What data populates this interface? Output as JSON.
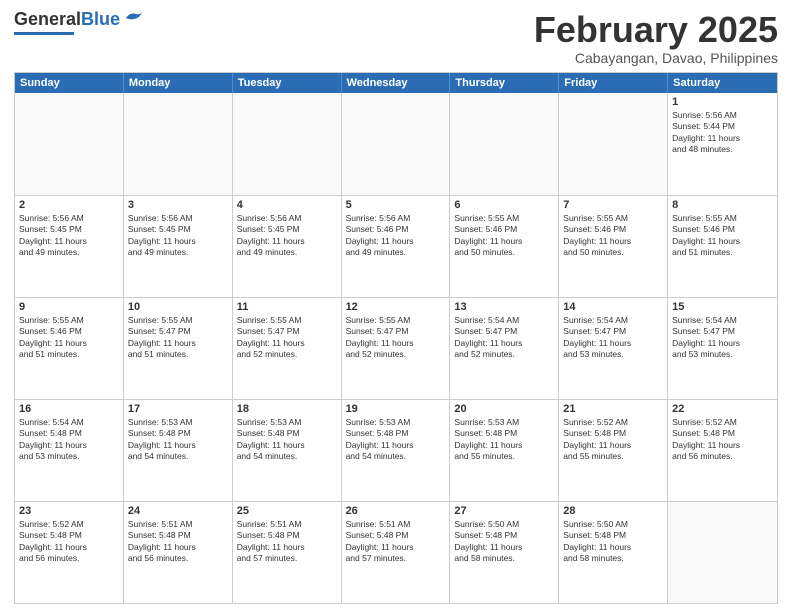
{
  "header": {
    "logo_general": "General",
    "logo_blue": "Blue",
    "month_year": "February 2025",
    "location": "Cabayangan, Davao, Philippines"
  },
  "weekdays": [
    "Sunday",
    "Monday",
    "Tuesday",
    "Wednesday",
    "Thursday",
    "Friday",
    "Saturday"
  ],
  "weeks": [
    [
      {
        "day": "",
        "info": ""
      },
      {
        "day": "",
        "info": ""
      },
      {
        "day": "",
        "info": ""
      },
      {
        "day": "",
        "info": ""
      },
      {
        "day": "",
        "info": ""
      },
      {
        "day": "",
        "info": ""
      },
      {
        "day": "1",
        "info": "Sunrise: 5:56 AM\nSunset: 5:44 PM\nDaylight: 11 hours\nand 48 minutes."
      }
    ],
    [
      {
        "day": "2",
        "info": "Sunrise: 5:56 AM\nSunset: 5:45 PM\nDaylight: 11 hours\nand 49 minutes."
      },
      {
        "day": "3",
        "info": "Sunrise: 5:56 AM\nSunset: 5:45 PM\nDaylight: 11 hours\nand 49 minutes."
      },
      {
        "day": "4",
        "info": "Sunrise: 5:56 AM\nSunset: 5:45 PM\nDaylight: 11 hours\nand 49 minutes."
      },
      {
        "day": "5",
        "info": "Sunrise: 5:56 AM\nSunset: 5:46 PM\nDaylight: 11 hours\nand 49 minutes."
      },
      {
        "day": "6",
        "info": "Sunrise: 5:55 AM\nSunset: 5:46 PM\nDaylight: 11 hours\nand 50 minutes."
      },
      {
        "day": "7",
        "info": "Sunrise: 5:55 AM\nSunset: 5:46 PM\nDaylight: 11 hours\nand 50 minutes."
      },
      {
        "day": "8",
        "info": "Sunrise: 5:55 AM\nSunset: 5:46 PM\nDaylight: 11 hours\nand 51 minutes."
      }
    ],
    [
      {
        "day": "9",
        "info": "Sunrise: 5:55 AM\nSunset: 5:46 PM\nDaylight: 11 hours\nand 51 minutes."
      },
      {
        "day": "10",
        "info": "Sunrise: 5:55 AM\nSunset: 5:47 PM\nDaylight: 11 hours\nand 51 minutes."
      },
      {
        "day": "11",
        "info": "Sunrise: 5:55 AM\nSunset: 5:47 PM\nDaylight: 11 hours\nand 52 minutes."
      },
      {
        "day": "12",
        "info": "Sunrise: 5:55 AM\nSunset: 5:47 PM\nDaylight: 11 hours\nand 52 minutes."
      },
      {
        "day": "13",
        "info": "Sunrise: 5:54 AM\nSunset: 5:47 PM\nDaylight: 11 hours\nand 52 minutes."
      },
      {
        "day": "14",
        "info": "Sunrise: 5:54 AM\nSunset: 5:47 PM\nDaylight: 11 hours\nand 53 minutes."
      },
      {
        "day": "15",
        "info": "Sunrise: 5:54 AM\nSunset: 5:47 PM\nDaylight: 11 hours\nand 53 minutes."
      }
    ],
    [
      {
        "day": "16",
        "info": "Sunrise: 5:54 AM\nSunset: 5:48 PM\nDaylight: 11 hours\nand 53 minutes."
      },
      {
        "day": "17",
        "info": "Sunrise: 5:53 AM\nSunset: 5:48 PM\nDaylight: 11 hours\nand 54 minutes."
      },
      {
        "day": "18",
        "info": "Sunrise: 5:53 AM\nSunset: 5:48 PM\nDaylight: 11 hours\nand 54 minutes."
      },
      {
        "day": "19",
        "info": "Sunrise: 5:53 AM\nSunset: 5:48 PM\nDaylight: 11 hours\nand 54 minutes."
      },
      {
        "day": "20",
        "info": "Sunrise: 5:53 AM\nSunset: 5:48 PM\nDaylight: 11 hours\nand 55 minutes."
      },
      {
        "day": "21",
        "info": "Sunrise: 5:52 AM\nSunset: 5:48 PM\nDaylight: 11 hours\nand 55 minutes."
      },
      {
        "day": "22",
        "info": "Sunrise: 5:52 AM\nSunset: 5:48 PM\nDaylight: 11 hours\nand 56 minutes."
      }
    ],
    [
      {
        "day": "23",
        "info": "Sunrise: 5:52 AM\nSunset: 5:48 PM\nDaylight: 11 hours\nand 56 minutes."
      },
      {
        "day": "24",
        "info": "Sunrise: 5:51 AM\nSunset: 5:48 PM\nDaylight: 11 hours\nand 56 minutes."
      },
      {
        "day": "25",
        "info": "Sunrise: 5:51 AM\nSunset: 5:48 PM\nDaylight: 11 hours\nand 57 minutes."
      },
      {
        "day": "26",
        "info": "Sunrise: 5:51 AM\nSunset: 5:48 PM\nDaylight: 11 hours\nand 57 minutes."
      },
      {
        "day": "27",
        "info": "Sunrise: 5:50 AM\nSunset: 5:48 PM\nDaylight: 11 hours\nand 58 minutes."
      },
      {
        "day": "28",
        "info": "Sunrise: 5:50 AM\nSunset: 5:48 PM\nDaylight: 11 hours\nand 58 minutes."
      },
      {
        "day": "",
        "info": ""
      }
    ]
  ]
}
